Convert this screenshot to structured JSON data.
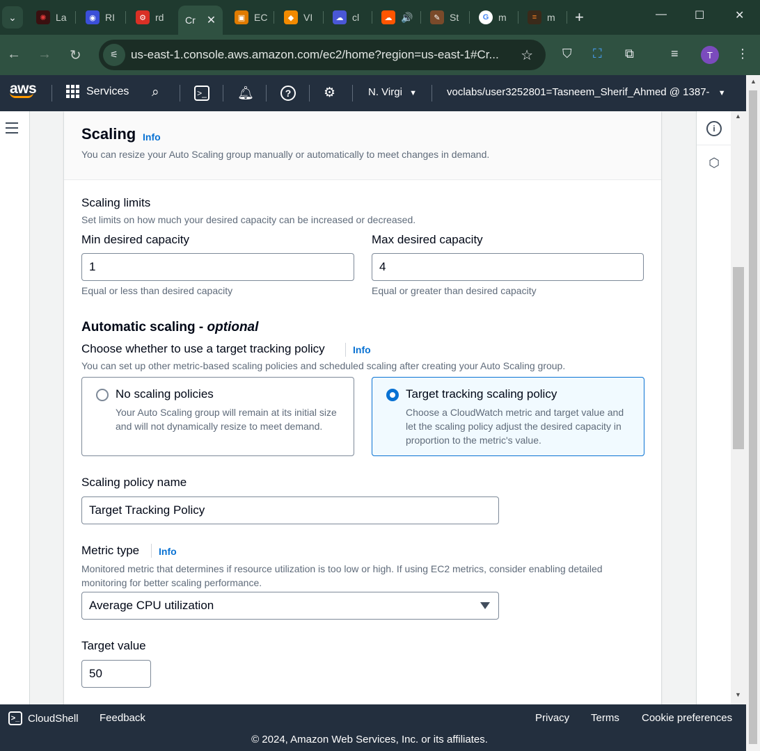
{
  "browser": {
    "tabs": [
      {
        "label": "La",
        "icon": "red-star-icon",
        "color": "#e03a3a"
      },
      {
        "label": "RI",
        "icon": "blue-robot-icon",
        "color": "#3b4fd8"
      },
      {
        "label": "rd",
        "icon": "red-gear-icon",
        "color": "#d93025"
      },
      {
        "label": "Cr",
        "icon": "aws-icon",
        "color": "#2f5141"
      },
      {
        "label": "EC",
        "icon": "ec2-icon",
        "color": "#e07b00"
      },
      {
        "label": "VI",
        "icon": "orange-cube-icon",
        "color": "#f28a00"
      },
      {
        "label": "cl",
        "icon": "cloud-icon",
        "color": "#4a57d6"
      },
      {
        "label": "",
        "icon": "soundcloud-icon",
        "color": "#ff5500"
      },
      {
        "label": "St",
        "icon": "brown-tool-icon",
        "color": "#7a4a2a"
      },
      {
        "label": "m",
        "icon": "google-icon",
        "color": "#ffffff"
      },
      {
        "label": "m",
        "icon": "stackoverflow-icon",
        "color": "#f48024"
      }
    ],
    "url": "us-east-1.console.aws.amazon.com/ec2/home?region=us-east-1#Cr...",
    "profile_initial": "T"
  },
  "aws_nav": {
    "logo": "aws",
    "services": "Services",
    "region": "N. Virgi",
    "account": "voclabs/user3252801=Tasneem_Sherif_Ahmed @ 1387-"
  },
  "scaling": {
    "title": "Scaling",
    "info": "Info",
    "description": "You can resize your Auto Scaling group manually or automatically to meet changes in demand.",
    "limits_title": "Scaling limits",
    "limits_desc": "Set limits on how much your desired capacity can be increased or decreased.",
    "min_label": "Min desired capacity",
    "min_value": "1",
    "min_hint": "Equal or less than desired capacity",
    "max_label": "Max desired capacity",
    "max_value": "4",
    "max_hint": "Equal or greater than desired capacity"
  },
  "auto": {
    "title": "Automatic scaling - ",
    "title_optional": "optional",
    "choose_label": "Choose whether to use a target tracking policy",
    "info": "Info",
    "choose_desc": "You can set up other metric-based scaling policies and scheduled scaling after creating your Auto Scaling group.",
    "option_none_title": "No scaling policies",
    "option_none_desc": "Your Auto Scaling group will remain at its initial size and will not dynamically resize to meet demand.",
    "option_target_title": "Target tracking scaling policy",
    "option_target_desc": "Choose a CloudWatch metric and target value and let the scaling policy adjust the desired capacity in proportion to the metric's value.",
    "selected": "target"
  },
  "policy": {
    "name_label": "Scaling policy name",
    "name_value": "Target Tracking Policy",
    "metric_label": "Metric type",
    "metric_info": "Info",
    "metric_desc": "Monitored metric that determines if resource utilization is too low or high. If using EC2 metrics, consider enabling detailed monitoring for better scaling performance.",
    "metric_value": "Average CPU utilization",
    "target_label": "Target value",
    "target_value": "50"
  },
  "footer": {
    "cloudshell": "CloudShell",
    "feedback": "Feedback",
    "privacy": "Privacy",
    "terms": "Terms",
    "cookies": "Cookie preferences",
    "copyright": "© 2024, Amazon Web Services, Inc. or its affiliates."
  },
  "colors": {
    "aws_nav_bg": "#232f3e",
    "link_blue": "#0972d3",
    "aws_orange": "#ff9900"
  }
}
